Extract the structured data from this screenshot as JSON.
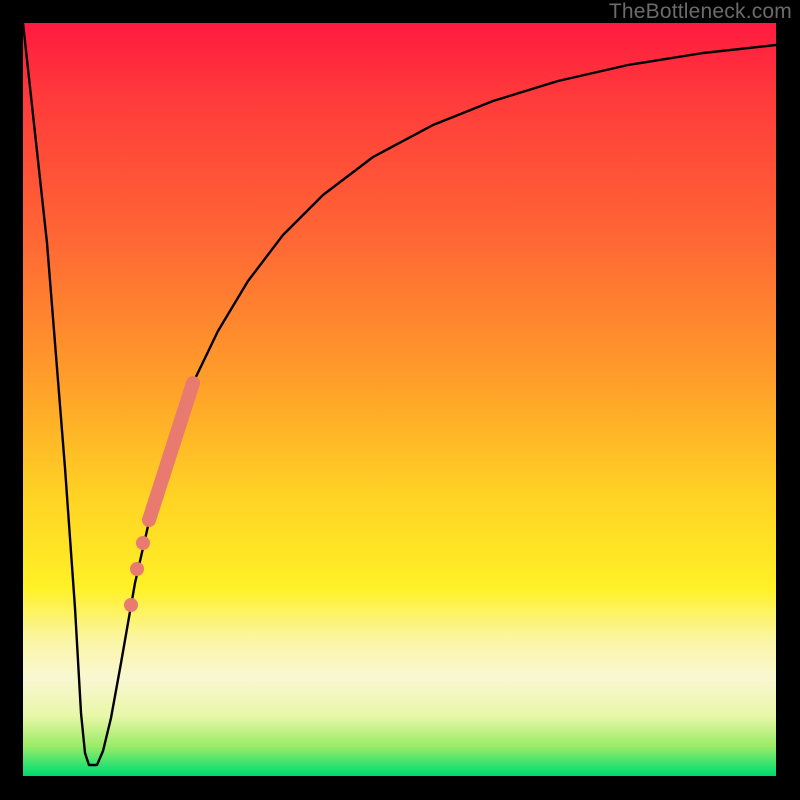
{
  "watermark": "TheBottleneck.com",
  "chart_data": {
    "type": "line",
    "title": "",
    "xlabel": "",
    "ylabel": "",
    "xlim": [
      0,
      100
    ],
    "ylim": [
      0,
      100
    ],
    "grid": false,
    "legend": false,
    "series": [
      {
        "name": "bottleneck-curve",
        "x": [
          0,
          2,
          4,
          6,
          7,
          8,
          9,
          10,
          11,
          13,
          15,
          18,
          21,
          24,
          27,
          30,
          34,
          38,
          43,
          50,
          58,
          66,
          75,
          85,
          95,
          100
        ],
        "y": [
          100,
          75,
          50,
          18,
          5,
          2,
          2,
          5,
          12,
          28,
          40,
          52,
          60,
          67,
          72,
          76,
          80,
          83,
          86,
          89,
          91,
          93,
          94.5,
          95.5,
          96.5,
          97
        ]
      }
    ],
    "highlight_segment": {
      "name": "salmon-thick-segment",
      "x_range": [
        16,
        22
      ],
      "y_range": [
        44,
        64
      ]
    },
    "highlight_points": [
      {
        "x": 15.0,
        "y": 40
      },
      {
        "x": 14.0,
        "y": 36
      },
      {
        "x": 13.2,
        "y": 31
      },
      {
        "x": 12.4,
        "y": 25
      }
    ],
    "background_gradient": {
      "top": "#ff1a3f",
      "mid_upper": "#ffa029",
      "mid": "#fff126",
      "mid_lower": "#f9f7d2",
      "bottom": "#00d868"
    }
  }
}
